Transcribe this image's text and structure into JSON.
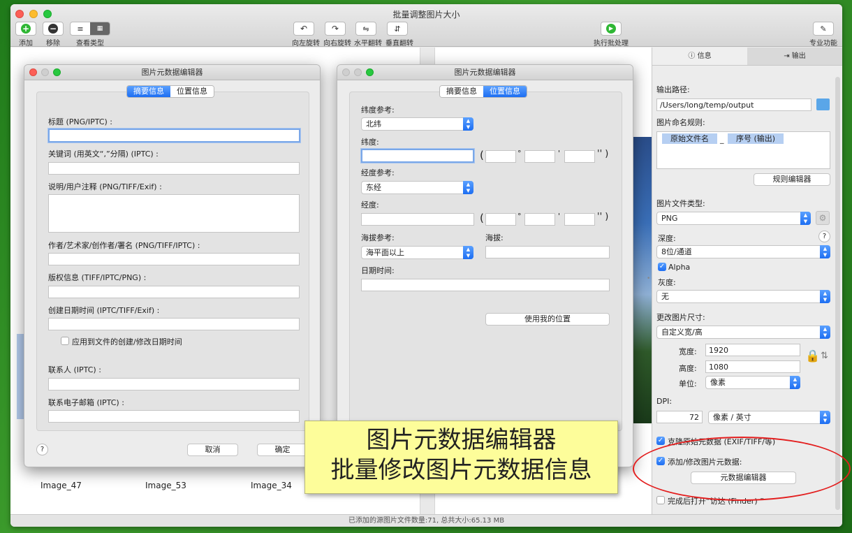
{
  "window": {
    "title": "批量调整图片大小"
  },
  "toolbar": {
    "add": "添加",
    "remove": "移除",
    "view_type": "查看类型",
    "rotate_left": "向左旋转",
    "rotate_right": "向右旋转",
    "flip_h": "水平翻转",
    "flip_v": "垂直翻转",
    "run": "执行批处理",
    "pro": "专业功能"
  },
  "thumbnails": [
    "Image_47",
    "Image_53",
    "Image_34"
  ],
  "status": "已添加的源图片文件数量:71, 总共大小:65.13 MB",
  "sidebar": {
    "tab_info": "信息",
    "tab_output": "输出",
    "output_path_label": "输出路径:",
    "output_path": "/Users/long/temp/output",
    "naming_label": "图片命名规则:",
    "token1": "原始文件名",
    "token_sep": "_",
    "token2": "序号 (输出)",
    "rule_editor": "规则编辑器",
    "file_type_label": "图片文件类型:",
    "file_type": "PNG",
    "depth_label": "深度:",
    "help": "?",
    "depth": "8位/通道",
    "alpha": "Alpha",
    "gray_label": "灰度:",
    "gray": "无",
    "resize_label": "更改图片尺寸:",
    "resize": "自定义宽/高",
    "width_label": "宽度:",
    "width": "1920",
    "height_label": "高度:",
    "height": "1080",
    "unit_label": "单位:",
    "unit": "像素",
    "dpi_label": "DPI:",
    "dpi": "72",
    "dpi_unit": "像素 / 英寸",
    "clone_meta": "克隆原始元数据 (EXIF/TIFF/等)",
    "add_meta": "添加/修改图片元数据:",
    "meta_editor": "元数据编辑器",
    "open_finder": "完成后打开“访达 (Finder) ”"
  },
  "dialog1": {
    "title": "图片元数据编辑器",
    "seg_summary": "摘要信息",
    "seg_location": "位置信息",
    "title_label": "标题 (PNG/IPTC) :",
    "keywords_label": "关键词 (用英文“,”分隔) (IPTC) :",
    "desc_label": "说明/用户注释 (PNG/TIFF/Exif) :",
    "author_label": "作者/艺术家/创作者/署名 (PNG/TIFF/IPTC) :",
    "copyright_label": "版权信息 (TIFF/IPTC/PNG) :",
    "created_label": "创建日期时间 (IPTC/TIFF/Exif) :",
    "apply_dates": "应用到文件的创建/修改日期时间",
    "contact_label": "联系人 (IPTC) :",
    "email_label": "联系电子邮箱 (IPTC) :",
    "help": "?",
    "cancel": "取消",
    "ok": "确定"
  },
  "dialog2": {
    "title": "图片元数据编辑器",
    "seg_summary": "摘要信息",
    "seg_location": "位置信息",
    "lat_ref_label": "纬度参考:",
    "lat_ref": "北纬",
    "lat_label": "纬度:",
    "lon_ref_label": "经度参考:",
    "lon_ref": "东经",
    "lon_label": "经度:",
    "alt_ref_label": "海拔参考:",
    "alt_ref": "海平面以上",
    "alt_label": "海拔:",
    "date_label": "日期时间:",
    "use_location": "使用我的位置",
    "paren_open": "(",
    "deg": "°",
    "min": "'",
    "sec": "'' )"
  },
  "banner": {
    "line1": "图片元数据编辑器",
    "line2": "批量修改图片元数据信息"
  },
  "colors": {
    "accent": "#1d6ef2",
    "highlight_oval": "#e31e1e",
    "banner": "#fdfd9a"
  }
}
